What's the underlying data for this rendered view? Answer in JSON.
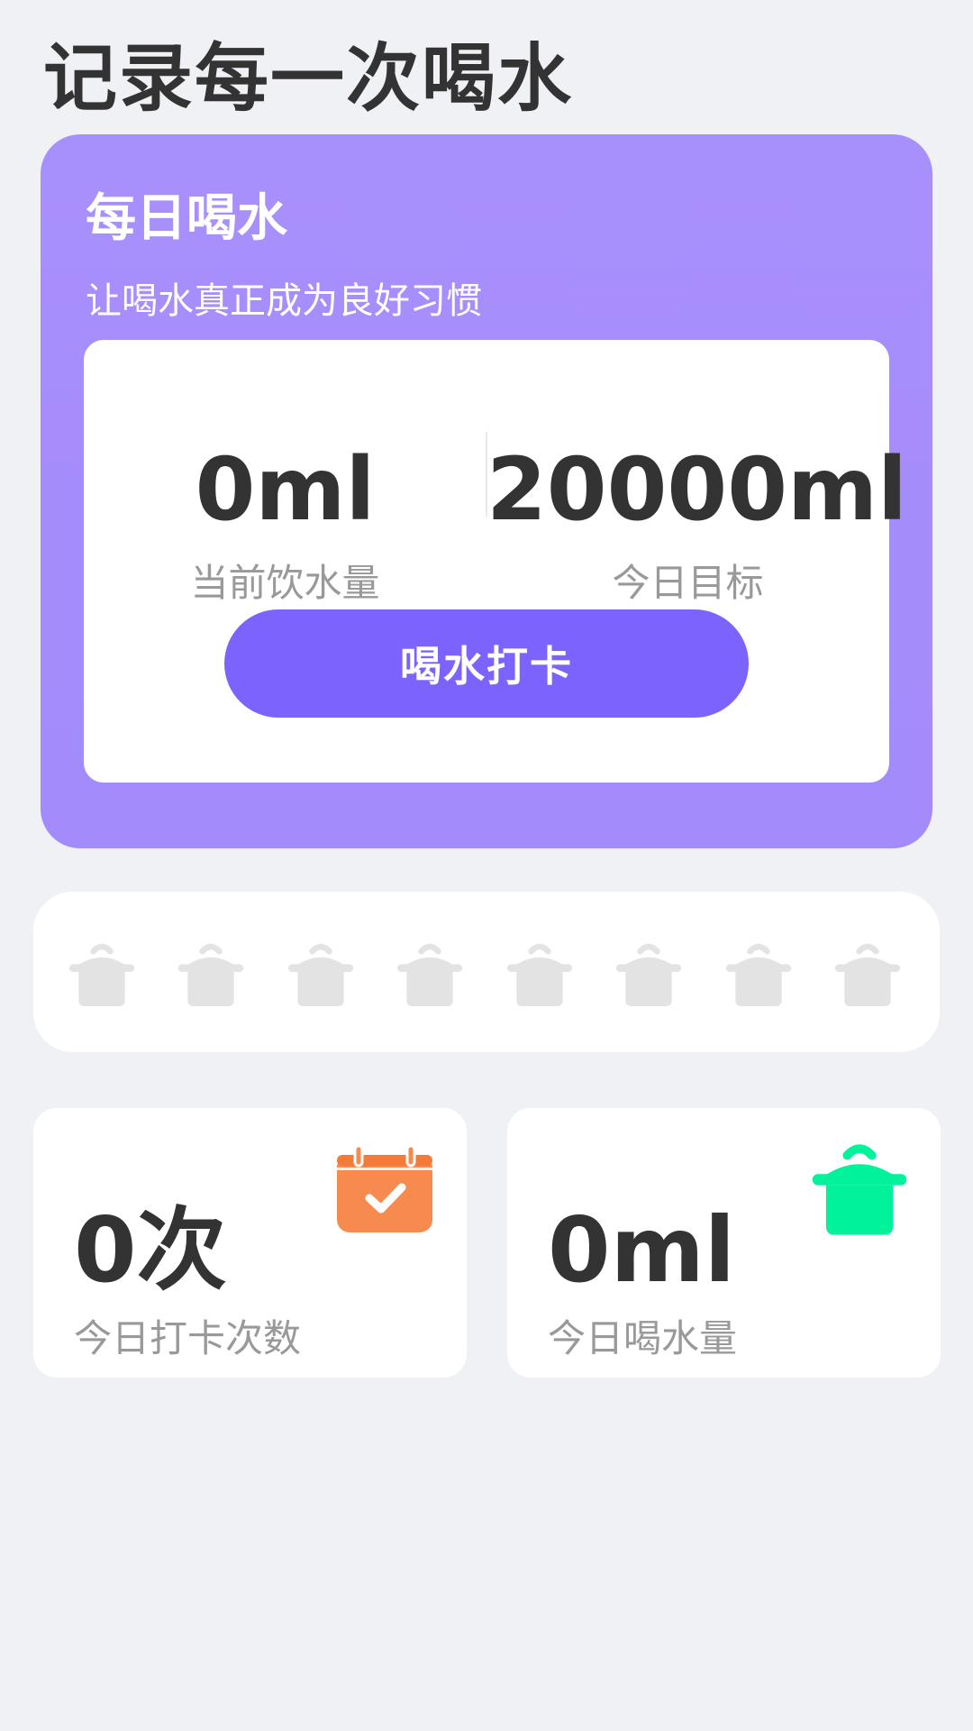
{
  "page": {
    "title": "记录每一次喝水"
  },
  "hero": {
    "title": "每日喝水",
    "subtitle": "让喝水真正成为良好习惯",
    "current": {
      "value": "0ml",
      "label": "当前饮水量"
    },
    "target": {
      "value": "20000ml",
      "label": "今日目标"
    },
    "checkin_button": "喝水打卡"
  },
  "cups": {
    "count": 8,
    "icon": "pot-icon",
    "empty_color": "#e3e3e3"
  },
  "stats": {
    "checkins": {
      "value": "0次",
      "label": "今日打卡次数",
      "icon": "calendar-check-icon",
      "color": "#f78a4f"
    },
    "water": {
      "value": "0ml",
      "label": "今日喝水量",
      "icon": "pot-icon",
      "color": "#00f29a"
    }
  },
  "colors": {
    "background": "#eff1f5",
    "hero_gradient_top": "#a890fc",
    "hero_gradient_bottom": "#a48bfb",
    "accent": "#7d63fd",
    "text_dark": "#333333",
    "text_muted": "#999999"
  }
}
